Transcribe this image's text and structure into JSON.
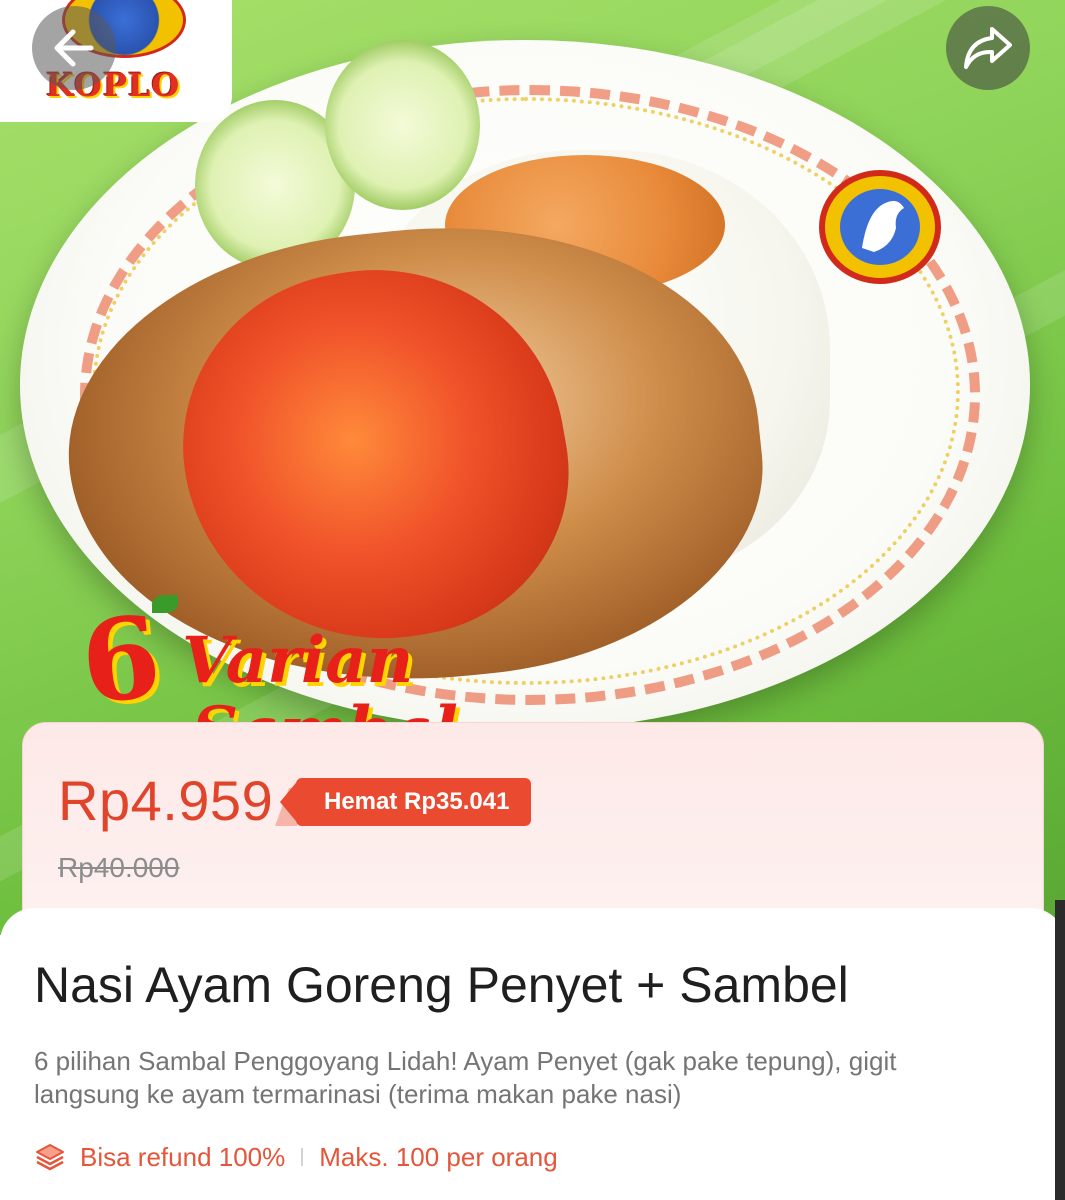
{
  "header": {
    "brand_logo_text": "KOPLO",
    "back_icon": "back-arrow-icon",
    "share_icon": "share-arrow-icon"
  },
  "hero": {
    "promo_number": "6",
    "promo_word_1": "Varian",
    "promo_word_2": "Sambal"
  },
  "pricing": {
    "current_price": "Rp4.959",
    "saving_label": "Hemat Rp35.041",
    "original_price": "Rp40.000",
    "accent_color": "#e0442a"
  },
  "product": {
    "title": "Nasi Ayam Goreng Penyet + Sambel",
    "description": "6 pilihan Sambal Penggoyang Lidah! Ayam Penyet (gak pake tepung), gigit langsung ke ayam termarinasi (terima makan pake nasi)"
  },
  "policy": {
    "icon": "layers-icon",
    "refund_label": "Bisa refund 100%",
    "limit_label": "Maks. 100 per orang"
  }
}
